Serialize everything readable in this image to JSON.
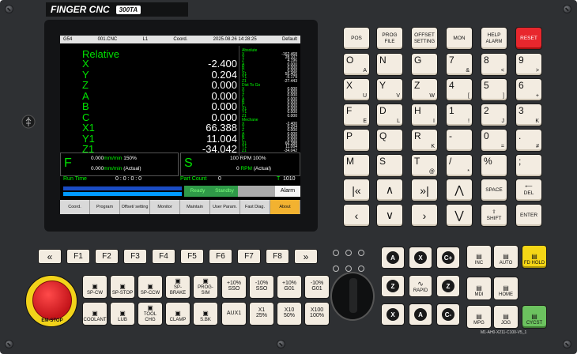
{
  "brand": {
    "name": "FINGER CNC",
    "model": "300TA"
  },
  "screen": {
    "topbar": {
      "mode": "G54",
      "program": "001.CNC",
      "line": "L1",
      "coord": "Coord.",
      "datetime": "2025.08.26 14:28:25",
      "default": "Default"
    },
    "relative": {
      "title": "Relative",
      "rows": [
        {
          "axis": "X",
          "value": "-2.400"
        },
        {
          "axis": "Y",
          "value": "0.204"
        },
        {
          "axis": "Z",
          "value": "0.000"
        },
        {
          "axis": "A",
          "value": "0.000"
        },
        {
          "axis": "B",
          "value": "0.000"
        },
        {
          "axis": "C",
          "value": "0.000"
        },
        {
          "axis": "X1",
          "value": "66.388"
        },
        {
          "axis": "Y1",
          "value": "11.004"
        },
        {
          "axis": "Z1",
          "value": "-34.042"
        }
      ]
    },
    "absolute": {
      "title": "Absolute",
      "rows": [
        {
          "axis": "X",
          "value": "-162.468"
        },
        {
          "axis": "Y",
          "value": "28.107"
        },
        {
          "axis": "Z",
          "value": "4.196"
        },
        {
          "axis": "A",
          "value": "0.000"
        },
        {
          "axis": "B",
          "value": "0.000"
        },
        {
          "axis": "C",
          "value": "0.000"
        },
        {
          "axis": "X1",
          "value": "55.405"
        },
        {
          "axis": "Y1",
          "value": "-5.179"
        },
        {
          "axis": "Z1",
          "value": "-27.443"
        }
      ]
    },
    "dist": {
      "title": "Dist To Go",
      "rows": [
        {
          "axis": "X",
          "value": "0.000"
        },
        {
          "axis": "Y",
          "value": "0.000"
        },
        {
          "axis": "Z",
          "value": "0.000"
        },
        {
          "axis": "A",
          "value": "0.000"
        },
        {
          "axis": "B",
          "value": "0.000"
        },
        {
          "axis": "C",
          "value": "0.000"
        },
        {
          "axis": "X1",
          "value": "0.000"
        },
        {
          "axis": "Y1",
          "value": "0.000"
        },
        {
          "axis": "Z1",
          "value": "0.000"
        }
      ]
    },
    "mech": {
      "title": "Mechane",
      "rows": [
        {
          "axis": "X",
          "value": "-2.400"
        },
        {
          "axis": "Y",
          "value": "0.204"
        },
        {
          "axis": "Z",
          "value": "0.000"
        },
        {
          "axis": "A",
          "value": "0.000"
        },
        {
          "axis": "B",
          "value": "0.000"
        },
        {
          "axis": "C",
          "value": "0.000"
        },
        {
          "axis": "X1",
          "value": "66.388"
        },
        {
          "axis": "Y1",
          "value": "11.004"
        },
        {
          "axis": "Z1",
          "value": "-34.042"
        }
      ]
    },
    "feed": {
      "letter": "F",
      "value1": "0.000",
      "unit1": "mm/min",
      "pct": "150",
      "pct_sign": "%",
      "value2": "0.000",
      "unit2": "mm/min",
      "actual": "(Actual)"
    },
    "spindle": {
      "letter": "S",
      "value1": "100",
      "unit1": "RPM",
      "pct": "100",
      "pct_sign": "%",
      "value2": "0",
      "unit2": "RPM",
      "actual": "(Actual)"
    },
    "run": {
      "label": "Run Time",
      "time": "0 : 0 : 0 : 0",
      "part_label": "Part Count",
      "part": "0",
      "tool_label": "T",
      "tool": "1010"
    },
    "status": {
      "ready": "Ready",
      "standby": "Standby",
      "alarm": "Alarm"
    },
    "softkeys": [
      {
        "label": "Coord."
      },
      {
        "label": "Program"
      },
      {
        "label": "Offset/ setting"
      },
      {
        "label": "Monitor"
      },
      {
        "label": "Maintain"
      },
      {
        "label": "User Param."
      },
      {
        "label": "Fast Diag."
      },
      {
        "label": "About"
      }
    ]
  },
  "mode_keys": [
    {
      "l1": "POS",
      "l2": ""
    },
    {
      "l1": "PROG",
      "l2": "FILE"
    },
    {
      "l1": "OFFSET",
      "l2": "SETTING"
    },
    {
      "l1": "MON",
      "l2": ""
    },
    {
      "l1": "HELP",
      "l2": "ALARM"
    },
    {
      "l1": "RESET",
      "l2": ""
    }
  ],
  "alpha_keys": [
    [
      "O",
      "N",
      "G",
      "7",
      "8",
      "9"
    ],
    [
      "X",
      "Y",
      "Z",
      "4",
      "5",
      "6"
    ],
    [
      "F",
      "D",
      "H",
      "1",
      "2",
      "3"
    ],
    [
      "P",
      "Q",
      "R",
      "-",
      "0",
      "."
    ],
    [
      "M",
      "S",
      "T",
      "/",
      "%",
      ";"
    ]
  ],
  "alpha_sub": [
    [
      "A",
      "",
      "",
      "&",
      "<",
      ">"
    ],
    [
      "U",
      "V",
      "W",
      "[",
      "]",
      "+"
    ],
    [
      "E",
      "L",
      "I",
      "!",
      "J",
      "K"
    ],
    [
      "",
      "",
      "K",
      "",
      "=",
      "#"
    ],
    [
      "",
      "",
      "@",
      "*",
      "",
      ""
    ]
  ],
  "nav_keys": {
    "space": "SPACE",
    "del": "DEL",
    "shift": "SHIFT",
    "enter": "ENTER"
  },
  "fn_keys": [
    "F1",
    "F2",
    "F3",
    "F4",
    "F5",
    "F6",
    "F7",
    "F8"
  ],
  "machine_keys": [
    {
      "label": "SP-CW"
    },
    {
      "label": "SP-STOP"
    },
    {
      "label": "SP-CCW"
    },
    {
      "label": "SP-BRAKE"
    },
    {
      "label": "PROG-SIM"
    },
    {
      "label": "COOLANT"
    },
    {
      "label": "LUB"
    },
    {
      "label": "TOOL CHG"
    },
    {
      "label": "CLAMP"
    },
    {
      "label": "S.BK"
    }
  ],
  "override_keys": [
    {
      "top": "+10%",
      "label": "SSO"
    },
    {
      "top": "-10%",
      "label": "SSO"
    },
    {
      "top": "+10%",
      "label": "G01"
    },
    {
      "top": "-10%",
      "label": "G01"
    },
    {
      "top": "",
      "label": "AUX1"
    },
    {
      "top": "X1",
      "label": "25%"
    },
    {
      "top": "X10",
      "label": "50%"
    },
    {
      "top": "X100",
      "label": "100%"
    }
  ],
  "jog_keys": {
    "a_plus": "A",
    "x_minus": "X",
    "c_plus": "C+",
    "z_minus": "Z",
    "rapid": "RAPID",
    "z_plus": "Z",
    "x_plus": "X",
    "a_minus": "A",
    "c_minus": "C-"
  },
  "right_keys": [
    {
      "label": "INC"
    },
    {
      "label": "AUTO"
    },
    {
      "label": "FD HOLD"
    },
    {
      "label": "MDI"
    },
    {
      "label": "HOME"
    },
    {
      "label": "MPG"
    },
    {
      "label": "JOG"
    },
    {
      "label": "CYCST"
    }
  ],
  "estop": {
    "label": "EM-STOP"
  },
  "serial": "M1-AH0-X211-C100-V5_1"
}
